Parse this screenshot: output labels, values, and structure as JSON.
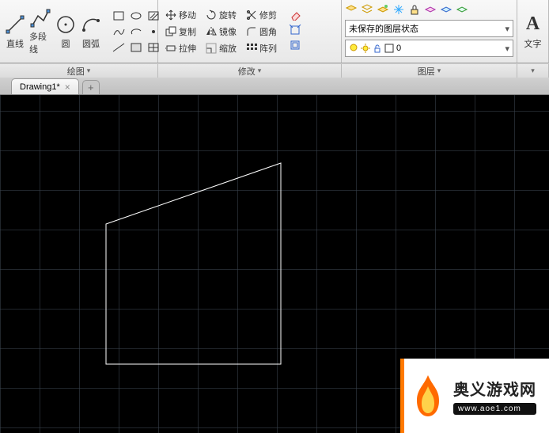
{
  "draw": {
    "line": "直线",
    "polyline": "多段线",
    "circle": "圆",
    "arc": "圆弧",
    "panel_label": "绘图"
  },
  "modify": {
    "move": "移动",
    "rotate": "旋转",
    "trim": "修剪",
    "copy": "复制",
    "mirror": "镜像",
    "fillet": "圆角",
    "stretch": "拉伸",
    "scale": "缩放",
    "array": "阵列",
    "panel_label": "修改"
  },
  "layers": {
    "unsaved": "未保存的图层状态",
    "current": "0",
    "panel_label": "图层"
  },
  "text": {
    "label": "文字"
  },
  "tab": {
    "name": "Drawing1*"
  },
  "watermark": {
    "title": "奥义游戏网",
    "url": "www.aoe1.com"
  }
}
